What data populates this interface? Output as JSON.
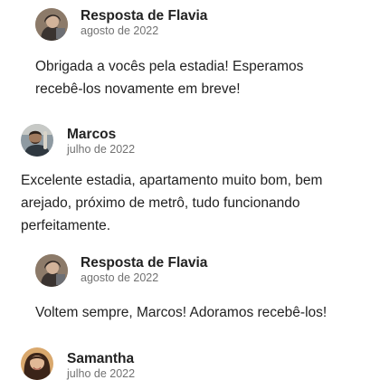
{
  "reviews": [
    {
      "kind": "reply",
      "name": "Resposta de Flavia",
      "date": "agosto de 2022",
      "text_lines": [
        "Obrigada a vocês pela estadia! Esperamos",
        "recebê-los novamente em breve!"
      ],
      "avatar_icon": "flavia-avatar"
    },
    {
      "kind": "review",
      "name": "Marcos",
      "date": "julho de 2022",
      "text_lines": [
        "Excelente estadia, apartamento muito bom, bem",
        "arejado, próximo de metrô, tudo funcionando",
        "perfeitamente."
      ],
      "avatar_icon": "marcos-avatar"
    },
    {
      "kind": "reply",
      "name": "Resposta de Flavia",
      "date": "agosto de 2022",
      "text_lines": [
        "Voltem sempre, Marcos! Adoramos recebê-los!"
      ],
      "avatar_icon": "flavia-avatar"
    },
    {
      "kind": "review",
      "name": "Samantha",
      "date": "julho de 2022",
      "text_lines": [],
      "avatar_icon": "samantha-avatar"
    }
  ]
}
